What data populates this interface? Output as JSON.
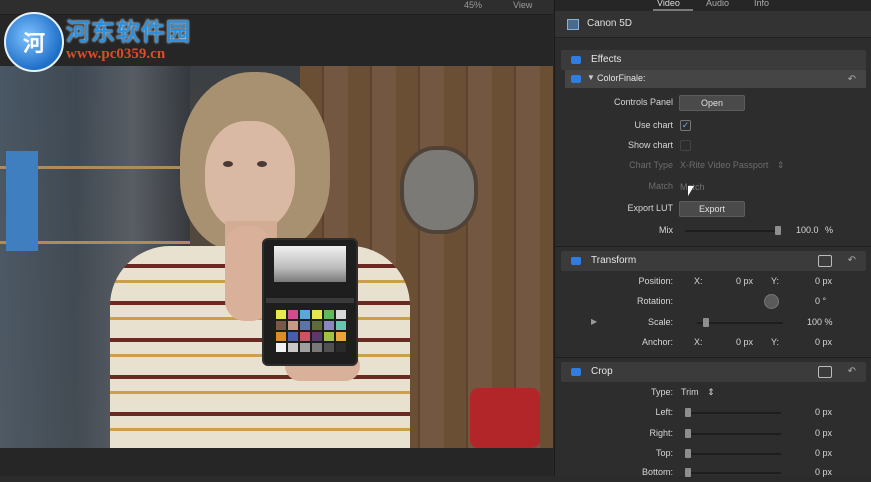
{
  "viewer": {
    "zoom": "45%",
    "view_menu": "View",
    "watermark": {
      "logo_text": "河",
      "title": "河东软件园",
      "url": "www.pc0359.cn"
    }
  },
  "inspector": {
    "tabs": [
      "Video",
      "Audio",
      "Info"
    ],
    "clip_name": "Canon 5D",
    "effects_title": "Effects",
    "effect_name": "ColorFinale:",
    "colorfinale": {
      "controls_panel_label": "Controls Panel",
      "controls_panel_button": "Open",
      "use_chart_label": "Use chart",
      "use_chart_checked": "✓",
      "show_chart_label": "Show chart",
      "chart_type_label": "Chart Type",
      "chart_type_value": "X-Rite Video Passport",
      "chart_type_arrows": "⇕",
      "match_label": "Match",
      "match_button": "Match",
      "export_lut_label": "Export LUT",
      "export_button": "Export",
      "mix_label": "Mix",
      "mix_value": "100.0",
      "mix_unit": "%",
      "mix_fraction": 1.0
    },
    "transform": {
      "title": "Transform",
      "position_label": "Position:",
      "position_x_axis": "X:",
      "position_x": "0 px",
      "position_y_axis": "Y:",
      "position_y": "0 px",
      "rotation_label": "Rotation:",
      "rotation_value": "0 °",
      "scale_label": "Scale:",
      "scale_value": "100 %",
      "scale_expand": "▶",
      "anchor_label": "Anchor:",
      "anchor_x_axis": "X:",
      "anchor_x": "0 px",
      "anchor_y_axis": "Y:",
      "anchor_y": "0 px"
    },
    "crop": {
      "title": "Crop",
      "type_label": "Type:",
      "type_value": "Trim",
      "type_arrows": "⇕",
      "left_label": "Left:",
      "left_value": "0 px",
      "right_label": "Right:",
      "right_value": "0 px",
      "top_label": "Top:",
      "top_value": "0 px",
      "bottom_label": "Bottom:",
      "bottom_value": "0 px"
    },
    "reset_icon": "↶"
  },
  "colors": {
    "accent": "#2f7de1",
    "panel_bg": "#2d2d2d",
    "section_bg": "#3b3b3b"
  }
}
